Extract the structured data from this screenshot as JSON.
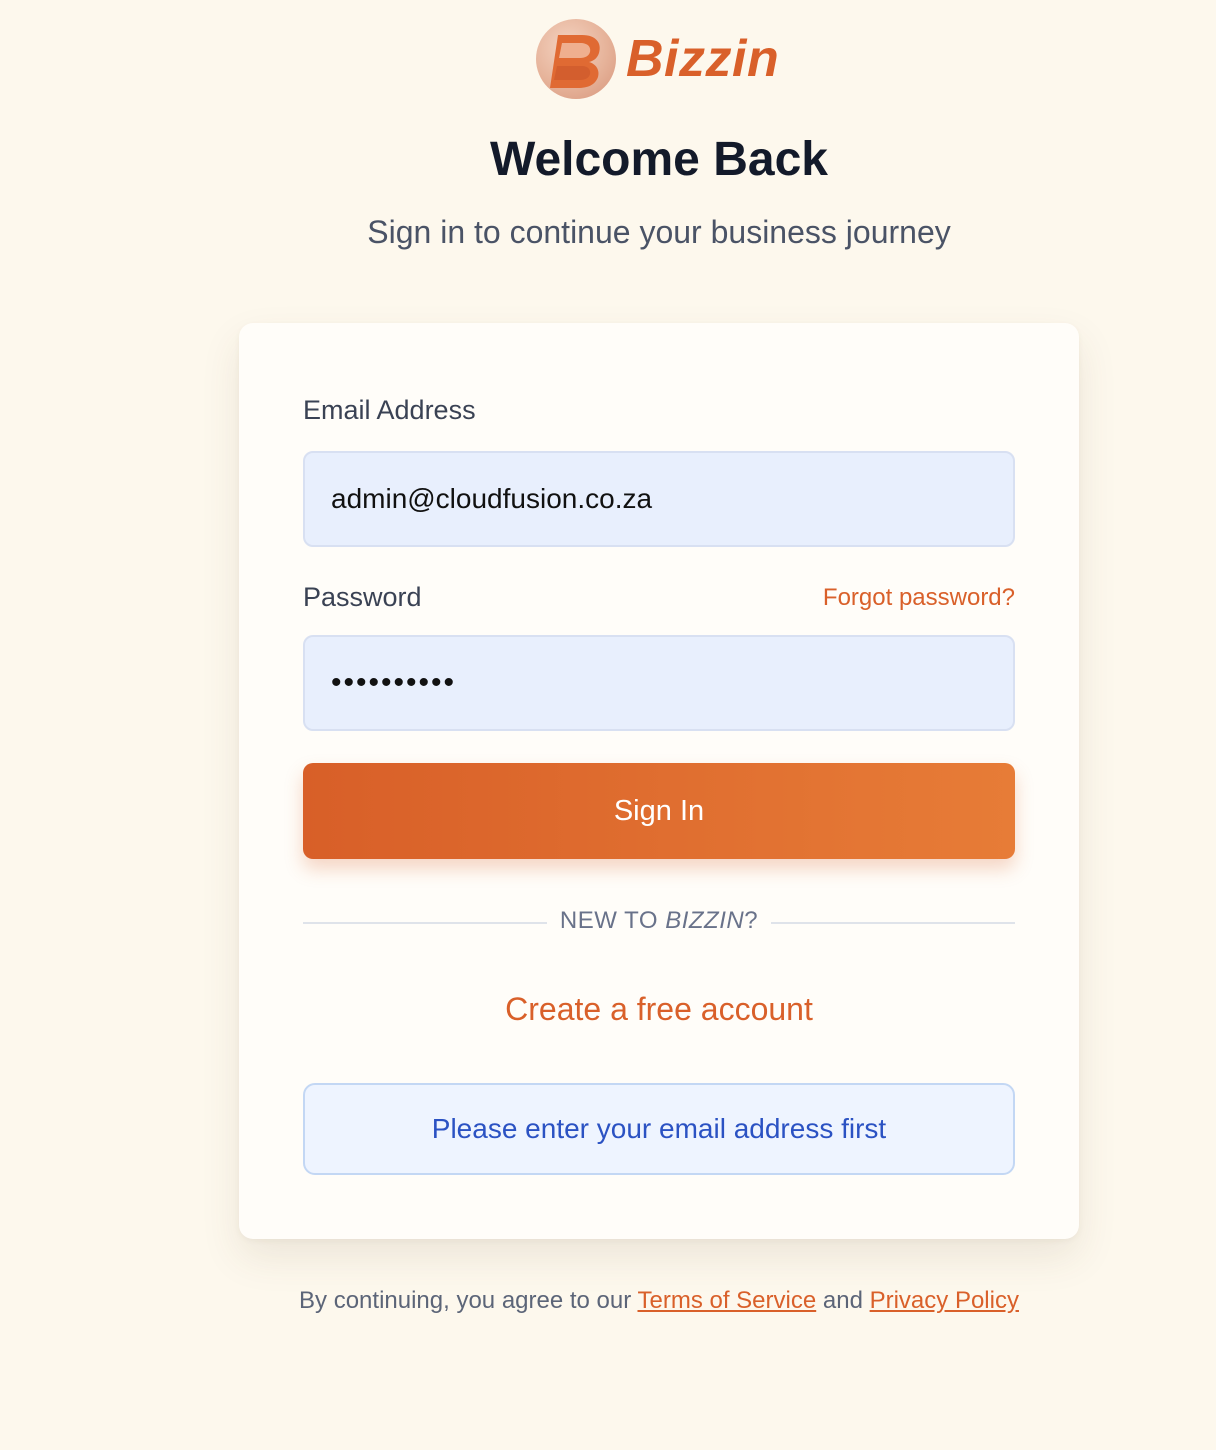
{
  "brand": {
    "name": "Bizzin",
    "logo_icon": "bizzin-b-logo-icon",
    "accent_color": "#d9602a"
  },
  "header": {
    "title": "Welcome Back",
    "subtitle": "Sign in to continue your business journey"
  },
  "form": {
    "email_label": "Email Address",
    "email_value": "admin@cloudfusion.co.za",
    "password_label": "Password",
    "forgot_password": "Forgot password?",
    "password_value": "••••••••••",
    "signin_label": "Sign In",
    "divider_prefix": "NEW TO ",
    "divider_brand": "BIZZIN",
    "divider_suffix": "?",
    "create_account": "Create a free account",
    "notice": "Please enter your email address first"
  },
  "footer": {
    "prefix": "By continuing, you agree to our",
    "terms": "Terms of Service",
    "conjunction": "and",
    "privacy": "Privacy Policy"
  }
}
